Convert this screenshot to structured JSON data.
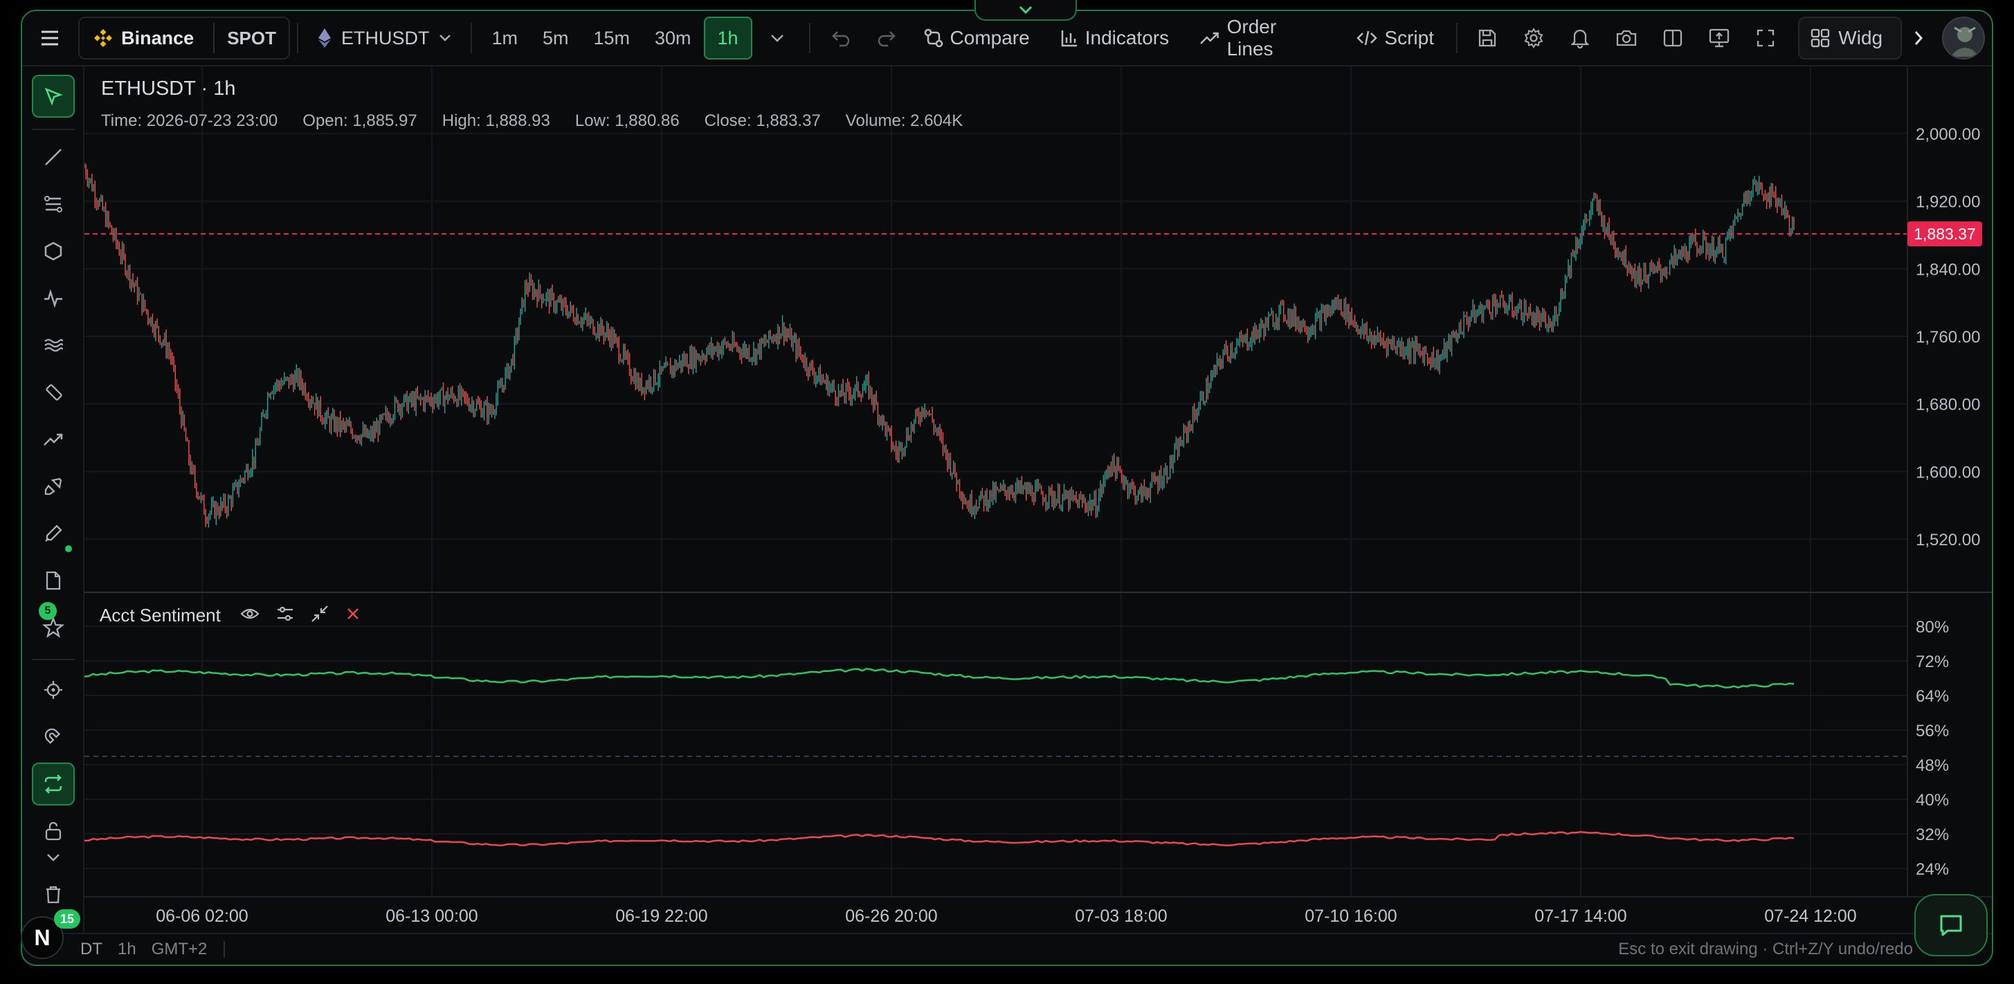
{
  "toolbar": {
    "exchange": "Binance",
    "market": "SPOT",
    "symbol": "ETHUSDT",
    "timeframes": [
      "1m",
      "5m",
      "15m",
      "30m",
      "1h"
    ],
    "active_timeframe": "1h",
    "compare_label": "Compare",
    "indicators_label": "Indicators",
    "order_lines_label": "Order Lines",
    "script_label": "Script",
    "widgets_label": "Widg"
  },
  "legend": {
    "title": "ETHUSDT · 1h",
    "time": "Time: 2026-07-23 23:00",
    "open": "Open: 1,885.97",
    "high": "High: 1,888.93",
    "low": "Low: 1,880.86",
    "close": "Close: 1,883.37",
    "volume": "Volume: 2.604K"
  },
  "price_badge": "1,883.37",
  "price_axis": [
    "2,000.00",
    "1,920.00",
    "1,840.00",
    "1,760.00",
    "1,680.00",
    "1,600.00",
    "1,520.00"
  ],
  "indicator": {
    "name": "Acct Sentiment",
    "axis": [
      "80%",
      "72%",
      "64%",
      "56%",
      "48%",
      "40%",
      "32%",
      "24%"
    ]
  },
  "time_axis": [
    "06-06 02:00",
    "06-13 00:00",
    "06-19 22:00",
    "06-26 20:00",
    "07-03 18:00",
    "07-10 16:00",
    "07-17 14:00",
    "07-24 12:00"
  ],
  "leftbar": {
    "favorites_count": "5"
  },
  "statusbar": {
    "symbol_fragment": "DT",
    "timeframe": "1h",
    "timezone": "GMT+2",
    "hint": "Esc to exit drawing · Ctrl+Z/Y undo/redo"
  },
  "notification_count": "15",
  "colors": {
    "up": "#26a69a",
    "down": "#ef5350",
    "accent": "#22c55e",
    "badge": "#e8264f"
  },
  "chart_data": {
    "type": "candlestick",
    "price_keypoints": [
      [
        0,
        1960
      ],
      [
        0.02,
        1880
      ],
      [
        0.04,
        1800
      ],
      [
        0.06,
        1740
      ],
      [
        0.075,
        1600
      ],
      [
        0.085,
        1550
      ],
      [
        0.1,
        1560
      ],
      [
        0.12,
        1620
      ],
      [
        0.13,
        1700
      ],
      [
        0.15,
        1710
      ],
      [
        0.17,
        1660
      ],
      [
        0.2,
        1640
      ],
      [
        0.22,
        1680
      ],
      [
        0.26,
        1690
      ],
      [
        0.285,
        1670
      ],
      [
        0.3,
        1730
      ],
      [
        0.31,
        1820
      ],
      [
        0.33,
        1800
      ],
      [
        0.37,
        1760
      ],
      [
        0.39,
        1700
      ],
      [
        0.42,
        1730
      ],
      [
        0.45,
        1750
      ],
      [
        0.47,
        1740
      ],
      [
        0.49,
        1770
      ],
      [
        0.51,
        1720
      ],
      [
        0.53,
        1690
      ],
      [
        0.55,
        1700
      ],
      [
        0.57,
        1620
      ],
      [
        0.59,
        1680
      ],
      [
        0.62,
        1560
      ],
      [
        0.65,
        1580
      ],
      [
        0.68,
        1570
      ],
      [
        0.71,
        1560
      ],
      [
        0.72,
        1610
      ],
      [
        0.74,
        1570
      ],
      [
        0.76,
        1600
      ],
      [
        0.78,
        1670
      ],
      [
        0.8,
        1740
      ],
      [
        0.82,
        1760
      ],
      [
        0.84,
        1790
      ],
      [
        0.86,
        1770
      ],
      [
        0.88,
        1800
      ],
      [
        0.9,
        1760
      ],
      [
        0.92,
        1750
      ],
      [
        0.94,
        1740
      ],
      [
        0.95,
        1730
      ],
      [
        0.97,
        1780
      ],
      [
        0.99,
        1800
      ],
      [
        1.01,
        1790
      ],
      [
        1.03,
        1770
      ],
      [
        1.045,
        1860
      ],
      [
        1.06,
        1920
      ],
      [
        1.07,
        1880
      ],
      [
        1.09,
        1830
      ],
      [
        1.11,
        1840
      ],
      [
        1.13,
        1870
      ],
      [
        1.15,
        1860
      ],
      [
        1.17,
        1940
      ],
      [
        1.19,
        1920
      ],
      [
        1.2,
        1883
      ]
    ]
  }
}
